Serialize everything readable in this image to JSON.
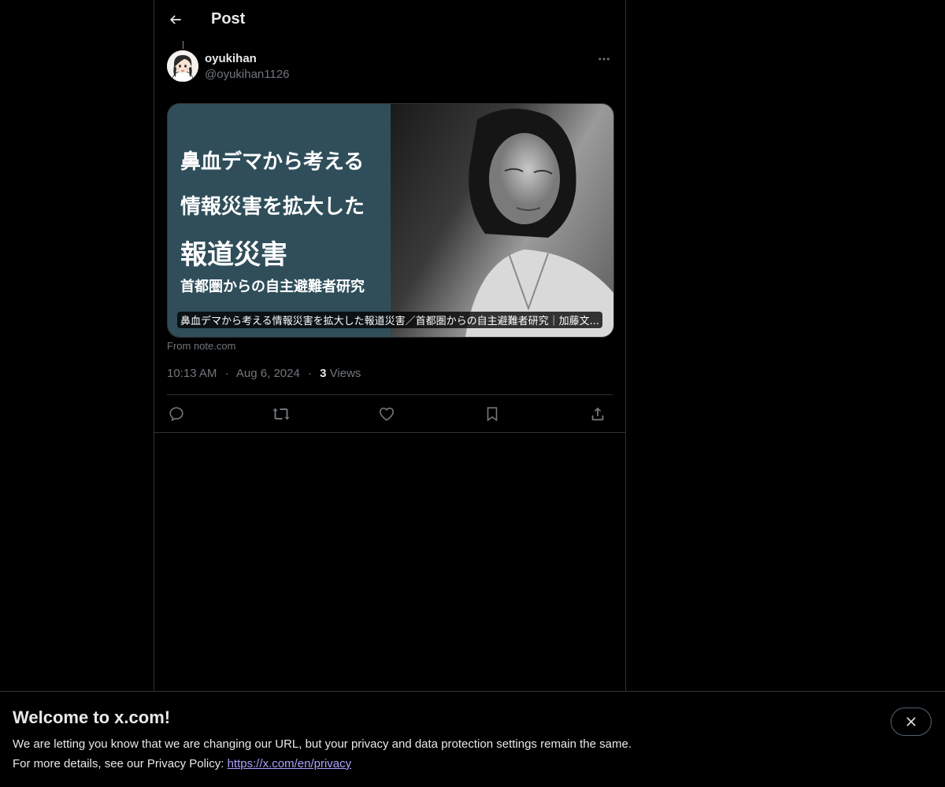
{
  "header": {
    "title": "Post",
    "back_icon": "arrow-left-icon"
  },
  "post": {
    "author": {
      "display_name": "oyukihan",
      "handle": "@oyukihan1126",
      "avatar_icon": "avatar-illustration"
    },
    "card": {
      "image_lines": [
        "鼻血デマから考える",
        "情報災害を拡大した",
        "報道災害",
        "首都圏からの自主避難者研究"
      ],
      "caption": "鼻血デマから考える情報災害を拡大した報道災害／首都圏からの自主避難者研究｜加藤文...",
      "source": "From note.com"
    },
    "time": "10:13 AM",
    "date": "Aug 6, 2024",
    "separator": "·",
    "views_count": "3",
    "views_label": "Views",
    "actions": [
      "reply-icon",
      "repost-icon",
      "like-icon",
      "bookmark-icon",
      "share-icon"
    ]
  },
  "banner": {
    "title": "Welcome to x.com!",
    "line1": "We are letting you know that we are changing our URL, but your privacy and data protection settings remain the same.",
    "line2_prefix": "For more details, see our Privacy Policy: ",
    "link_text": "https://x.com/en/privacy",
    "close_icon": "close-icon"
  },
  "colors": {
    "background": "#000000",
    "text_primary": "#e7e9ea",
    "text_secondary": "#71767b",
    "border": "#2f3336",
    "link": "#a7a4ff",
    "card_panel": "#2f4e5a"
  }
}
